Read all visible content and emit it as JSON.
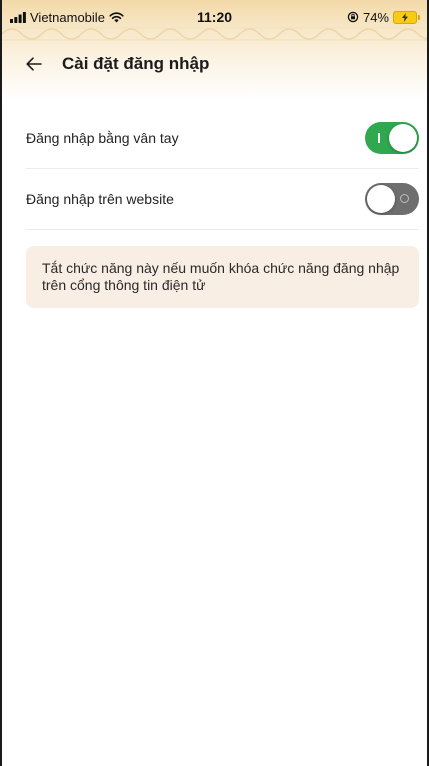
{
  "status_bar": {
    "carrier": "Vietnamobile",
    "time": "11:20",
    "battery_percent": "74%",
    "icons": [
      "signal-icon",
      "wifi-icon",
      "rotation-lock-icon",
      "battery-charging-icon"
    ]
  },
  "nav": {
    "title": "Cài đặt đăng nhập",
    "back_icon": "arrow-left-icon"
  },
  "settings": [
    {
      "label": "Đăng nhập bằng vân tay",
      "enabled": true
    },
    {
      "label": "Đăng nhập trên website",
      "enabled": false
    }
  ],
  "info": {
    "text": "Tắt chức năng này nếu muốn khóa chức năng đăng nhập trên cổng thông tin điện tử"
  },
  "colors": {
    "toggle_on": "#2fa84f",
    "toggle_off": "#6e6e6e",
    "info_background": "#f8eee3",
    "header_accent": "#f3d9a8",
    "battery": "#f7cb17"
  }
}
